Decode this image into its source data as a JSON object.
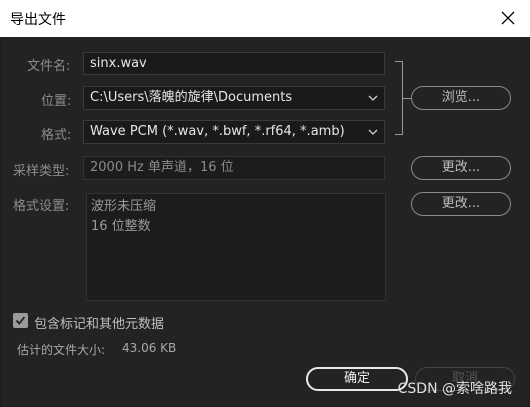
{
  "window": {
    "title": "导出文件"
  },
  "form": {
    "filename": {
      "label": "文件名:",
      "value": "sinx.wav"
    },
    "location": {
      "label": "位置:",
      "value": "C:\\Users\\落魄的旋律\\Documents",
      "browse_label": "浏览..."
    },
    "format": {
      "label": "格式:",
      "value": "Wave PCM (*.wav, *.bwf, *.rf64, *.amb)"
    },
    "sample_type": {
      "label": "采样类型:",
      "value": "2000 Hz 单声道，16 位",
      "change_label": "更改..."
    },
    "format_settings": {
      "label": "格式设置:",
      "lines": [
        "波形未压缩",
        "16 位整数"
      ],
      "change_label": "更改..."
    }
  },
  "options": {
    "include_markers_label": "包含标记和其他元数据",
    "include_markers_checked": true
  },
  "estimate": {
    "label": "估计的文件大小:",
    "value": "43.06 KB"
  },
  "footer": {
    "ok_label": "确定",
    "cancel_label": "取消"
  },
  "watermark": "CSDN @索啥路我",
  "icons": {
    "close": "close-icon",
    "dropdown": "chevron-down-icon",
    "check": "check-icon"
  }
}
